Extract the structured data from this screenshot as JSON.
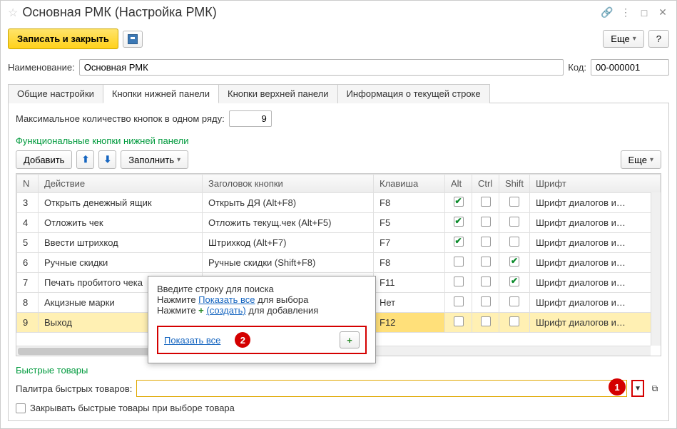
{
  "title": "Основная РМК (Настройка РМК)",
  "toolbar": {
    "save_close": "Записать и закрыть",
    "more": "Еще",
    "help": "?"
  },
  "fields": {
    "name_label": "Наименование:",
    "name_value": "Основная РМК",
    "code_label": "Код:",
    "code_value": "00-000001"
  },
  "tabs": {
    "t1": "Общие настройки",
    "t2": "Кнопки нижней панели",
    "t3": "Кнопки верхней панели",
    "t4": "Информация о текущей строке"
  },
  "panel": {
    "max_label": "Максимальное количество кнопок в одном ряду:",
    "max_value": "9",
    "func_header": "Функциональные кнопки нижней панели",
    "add": "Добавить",
    "fill": "Заполнить",
    "more": "Еще"
  },
  "cols": {
    "n": "N",
    "action": "Действие",
    "header": "Заголовок кнопки",
    "key": "Клавиша",
    "alt": "Alt",
    "ctrl": "Ctrl",
    "shift": "Shift",
    "font": "Шрифт"
  },
  "rows": [
    {
      "n": "3",
      "action": "Открыть денежный ящик",
      "header": "Открыть ДЯ (Alt+F8)",
      "key": "F8",
      "alt": true,
      "ctrl": false,
      "shift": false,
      "font": "Шрифт диалогов и…"
    },
    {
      "n": "4",
      "action": "Отложить чек",
      "header": "Отложить текущ.чек (Alt+F5)",
      "key": "F5",
      "alt": true,
      "ctrl": false,
      "shift": false,
      "font": "Шрифт диалогов и…"
    },
    {
      "n": "5",
      "action": "Ввести штрихкод",
      "header": "Штрихкод (Alt+F7)",
      "key": "F7",
      "alt": true,
      "ctrl": false,
      "shift": false,
      "font": "Шрифт диалогов и…"
    },
    {
      "n": "6",
      "action": "Ручные скидки",
      "header": "Ручные скидки (Shift+F8)",
      "key": "F8",
      "alt": false,
      "ctrl": false,
      "shift": true,
      "font": "Шрифт диалогов и…"
    },
    {
      "n": "7",
      "action": "Печать пробитого чека",
      "header": "",
      "key": "F11",
      "alt": false,
      "ctrl": false,
      "shift": true,
      "font": "Шрифт диалогов и…"
    },
    {
      "n": "8",
      "action": "Акцизные марки",
      "header": "",
      "key": "Нет",
      "alt": false,
      "ctrl": false,
      "shift": false,
      "font": "Шрифт диалогов и…"
    },
    {
      "n": "9",
      "action": "Выход",
      "header": "",
      "key": "F12",
      "alt": false,
      "ctrl": false,
      "shift": false,
      "font": "Шрифт диалогов и…",
      "sel": true
    }
  ],
  "popup": {
    "l1": "Введите строку для поиска",
    "l2a": "Нажмите ",
    "l2link": "Показать все",
    "l2b": " для выбора",
    "l3a": "Нажмите ",
    "l3link": "(создать)",
    "l3b": " для добавления",
    "show_all": "Показать все",
    "callout": "2"
  },
  "quick": {
    "header": "Быстрые товары",
    "palette_label": "Палитра быстрых товаров:",
    "close_on_pick": "Закрывать быстрые товары при выборе товара",
    "callout": "1"
  }
}
